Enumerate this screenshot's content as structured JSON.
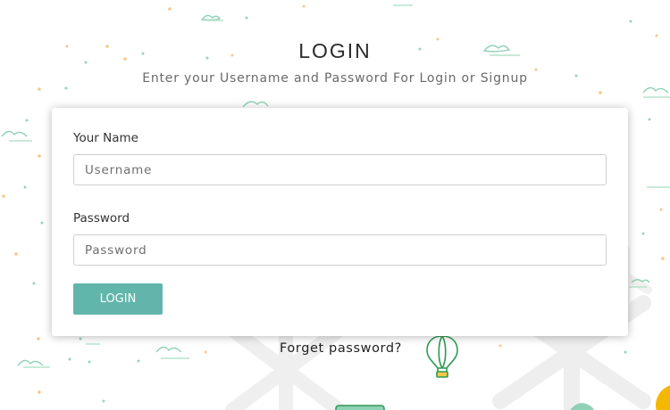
{
  "header": {
    "title": "LOGIN",
    "subtitle": "Enter your Username and Password For Login or Signup"
  },
  "form": {
    "username_label": "Your Name",
    "username_placeholder": "Username",
    "username_value": "",
    "password_label": "Password",
    "password_placeholder": "Password",
    "password_value": "",
    "login_button_label": "LOGIN"
  },
  "links": {
    "forgot_password": "Forget password?"
  },
  "colors": {
    "accent": "#62b5aa",
    "cloud": "#8fd1b4",
    "dot_orange": "#f5c88a",
    "dot_teal": "#9ccfc7",
    "balloon": "#2f9a52",
    "sun": "#f5b800"
  },
  "decorations": [
    "cloud-icon",
    "snowflake-icon",
    "hot-air-balloon-icon",
    "sun-icon"
  ]
}
